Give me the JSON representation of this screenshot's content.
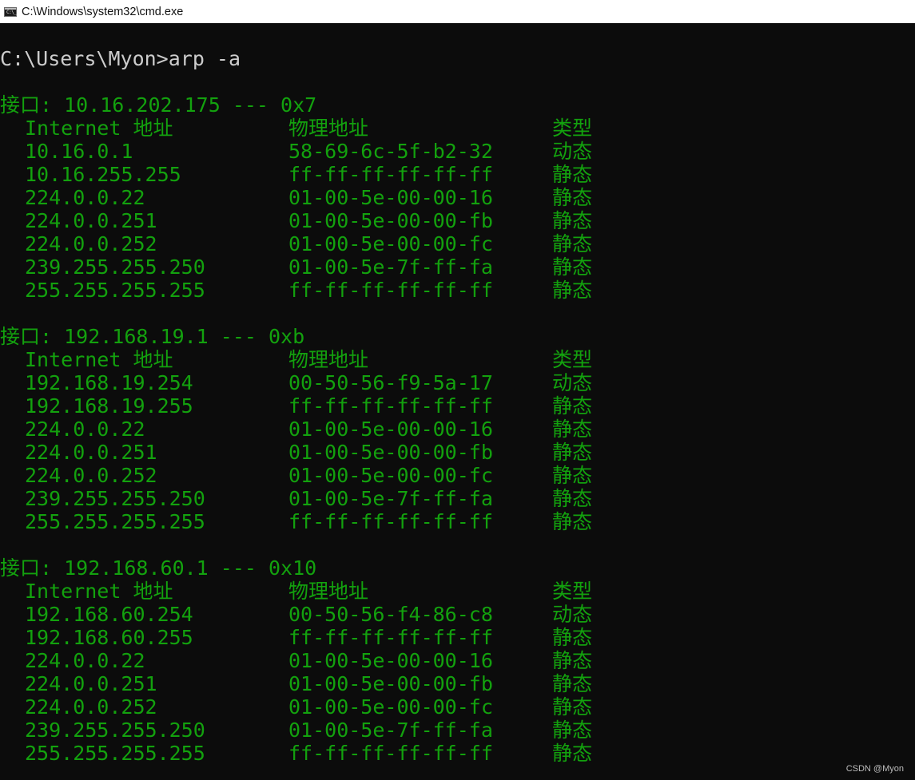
{
  "window": {
    "title": "C:\\Windows\\system32\\cmd.exe",
    "icon_text": "C:\\_"
  },
  "console": {
    "prompt": "C:\\Users\\Myon>arp -a",
    "interfaces": [
      {
        "header": "接口: 10.16.202.175 --- 0x7",
        "columns": {
          "ip": "Internet 地址",
          "mac": "物理地址",
          "type": "类型"
        },
        "rows": [
          {
            "ip": "10.16.0.1",
            "mac": "58-69-6c-5f-b2-32",
            "type": "动态"
          },
          {
            "ip": "10.16.255.255",
            "mac": "ff-ff-ff-ff-ff-ff",
            "type": "静态"
          },
          {
            "ip": "224.0.0.22",
            "mac": "01-00-5e-00-00-16",
            "type": "静态"
          },
          {
            "ip": "224.0.0.251",
            "mac": "01-00-5e-00-00-fb",
            "type": "静态"
          },
          {
            "ip": "224.0.0.252",
            "mac": "01-00-5e-00-00-fc",
            "type": "静态"
          },
          {
            "ip": "239.255.255.250",
            "mac": "01-00-5e-7f-ff-fa",
            "type": "静态"
          },
          {
            "ip": "255.255.255.255",
            "mac": "ff-ff-ff-ff-ff-ff",
            "type": "静态"
          }
        ]
      },
      {
        "header": "接口: 192.168.19.1 --- 0xb",
        "columns": {
          "ip": "Internet 地址",
          "mac": "物理地址",
          "type": "类型"
        },
        "rows": [
          {
            "ip": "192.168.19.254",
            "mac": "00-50-56-f9-5a-17",
            "type": "动态"
          },
          {
            "ip": "192.168.19.255",
            "mac": "ff-ff-ff-ff-ff-ff",
            "type": "静态"
          },
          {
            "ip": "224.0.0.22",
            "mac": "01-00-5e-00-00-16",
            "type": "静态"
          },
          {
            "ip": "224.0.0.251",
            "mac": "01-00-5e-00-00-fb",
            "type": "静态"
          },
          {
            "ip": "224.0.0.252",
            "mac": "01-00-5e-00-00-fc",
            "type": "静态"
          },
          {
            "ip": "239.255.255.250",
            "mac": "01-00-5e-7f-ff-fa",
            "type": "静态"
          },
          {
            "ip": "255.255.255.255",
            "mac": "ff-ff-ff-ff-ff-ff",
            "type": "静态"
          }
        ]
      },
      {
        "header": "接口: 192.168.60.1 --- 0x10",
        "columns": {
          "ip": "Internet 地址",
          "mac": "物理地址",
          "type": "类型"
        },
        "rows": [
          {
            "ip": "192.168.60.254",
            "mac": "00-50-56-f4-86-c8",
            "type": "动态"
          },
          {
            "ip": "192.168.60.255",
            "mac": "ff-ff-ff-ff-ff-ff",
            "type": "静态"
          },
          {
            "ip": "224.0.0.22",
            "mac": "01-00-5e-00-00-16",
            "type": "静态"
          },
          {
            "ip": "224.0.0.251",
            "mac": "01-00-5e-00-00-fb",
            "type": "静态"
          },
          {
            "ip": "224.0.0.252",
            "mac": "01-00-5e-00-00-fc",
            "type": "静态"
          },
          {
            "ip": "239.255.255.250",
            "mac": "01-00-5e-7f-ff-fa",
            "type": "静态"
          },
          {
            "ip": "255.255.255.255",
            "mac": "ff-ff-ff-ff-ff-ff",
            "type": "静态"
          }
        ]
      }
    ]
  },
  "watermark": "CSDN @Myon⁠",
  "colors": {
    "console_background": "#0c0c0c",
    "console_text": "#13a10e",
    "prompt_text": "#cccccc",
    "titlebar_background": "#ffffff"
  }
}
